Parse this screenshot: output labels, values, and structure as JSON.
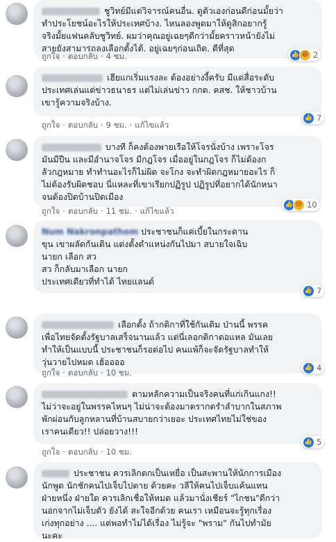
{
  "actions": {
    "like": "ถูกใจ",
    "reply": "ตอบกลับ",
    "edited": "แก้ไขแล้ว",
    "dot": "·"
  },
  "comments": [
    {
      "text": "ชูวิทย์มีแต่วิจารณ์คนอื่น. ดูตัวเองก่อนดีก่อนมั้ยว่า\nทำประโยชน์อะไรให้ประเทศบ้าง. ไหนลองพูดมาให้ดูสิกอยากรู้\nจริงมั้ยแฟนคลับชูวิทย์. ผมว่าคุณอยู่เฉยๆดีกว่ามั้ยคราวหน้ายังไม่\nสายยังสามารถลงเลือกตั้งได้. อยู่เฉยๆก่อนเถิด. ดีที่สุด",
      "time": "4 ชม.",
      "reactions": [
        "like",
        "haha"
      ],
      "count": "2"
    },
    {
      "text": "เฮียแกเริ่มแรงละ ต้องอย่างงี้ครับ มีแต่สื่อระดับ\nประเทศเล่นแต่ข่าวธนาธร แต่ไม่เล่นข่าว กกต. คสช. ให้ชาวบ้าน\nเขารู้ความจริงบ้าง.",
      "time": "9 ชม.",
      "edited": true,
      "reactions": [
        "like"
      ],
      "count": "7"
    },
    {
      "text": "บางที ก็คงต้องพายเรือให้โจรนั่งบ้าง เพราะโจร\nมันมีปืน และมีอำนาจโจร มีกฎโจร เมื่ออยู่ในกฎโจร ก็ไม่ต้องก\nลัวกฎหมาย ทำทำนอะไรก็ไม่ผิด จะโกง จะทำผิดกฎหมายอะไร ก็\nไม่ต้องรับผิดชอบ นี่แหละที่เขาเรียกปฏิรูป ปฏิรูปที่อยากได้นักหนา\nจนต้องปิดบ้านปิดเมือง",
      "time": "11 ชม.",
      "edited": true,
      "reactions": [
        "like",
        "sad"
      ],
      "count": "10"
    },
    {
      "name": "Num Nakronpathom",
      "text": "ประชาชนก็แค่เบี้ยในกระดาน\nขุน เขาผลัดกันเดิน แต่งตั้งตำแหน่งกันไปมา สบายใจเฉิบ\nนายก เลือก สว\nสว ก็กลับมาเลือก นายก\nประเทศเดียวที่ทำได้ ไทยแลนด์",
      "time": "",
      "reactions": [
        "like"
      ],
      "count": "7"
    },
    {
      "text": "เลือกตั้ง ถ้ากติกาที่ใช้กันเดิม ป่านนี้ พรรค\nเพื่อไทยจัดตั้งรัฐบาลเสร็จนานแล้ว แต่นี่เลอกติกาตอแหล มันเลย\nทำให้เป็นแบบนี้ ประชาชนก็รอต่อไป คนแพ้ก็จะจัดรัฐบาลทำให้\nวุ่นวายไปหมด เฮ้ออออ",
      "time": "10 ชม.",
      "reactions": [
        "like"
      ],
      "count": "4"
    },
    {
      "text": "ตามหลักความเป็นจริงคนที่แก่เกินแกง!!\nไม่ว่าจะอยู่ในพรรคไหนๆ ไม่น่าจะต้องมาตรากตรำลำบากในสภาพ\nพักผ่อนกับลูกหลานที่บ้านสบายกว่าเยอะ ประเทศไทยไม่ใช่ของ\nเราคนเดียว!! ปล่อยวาง!!!",
      "time": "10 ชม.",
      "reactions": [
        "like"
      ],
      "count": "5"
    },
    {
      "text": "ประชาชน ควรเลิกตกเป็นเหยื่อ เป็นสะพานให้นักการเมือง\nนักพูด นักชักคนไปเจ็บไปตาย ด้วยคะ วลีให้คนไปเจ็บแค้นแทน\nฝ่ายหนึ่ง ฝ่ายใด ควรเลิกเชื่อให้หมด แล้วมานั่งเชียร์ \"ไกชน\"ดีกว่า\nนอกจากไม่เจ็บตัว ยังได้ สะใจอีกด้วย คนเรา เหมือนจะรู้ทุกเรื่อง\nเก่งทุกอย่าง .... แต่พอทำไม่ได้เรื่อง ไม่รู้จะ \"พราม\" กันไปทำมัย\nนะคะ",
      "time": "",
      "reactions": [],
      "count": ""
    }
  ]
}
